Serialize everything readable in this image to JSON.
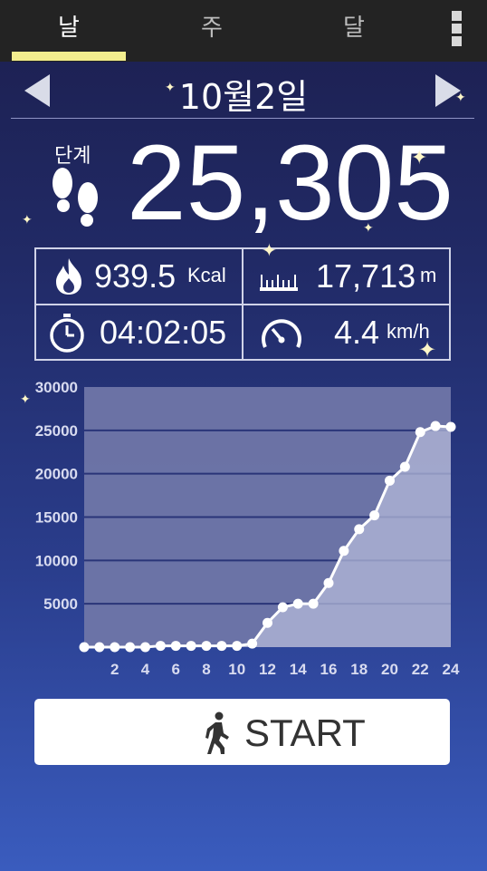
{
  "tabs": [
    {
      "label": "날",
      "active": true
    },
    {
      "label": "주",
      "active": false
    },
    {
      "label": "달",
      "active": false
    }
  ],
  "menu": {
    "icon": "more-vertical-icon"
  },
  "date": {
    "label": "10월2일",
    "prev_icon": "triangle-left-icon",
    "next_icon": "triangle-right-icon"
  },
  "steps": {
    "label": "단계",
    "value": "25,305",
    "icon": "footprints-icon"
  },
  "stats": {
    "calories": {
      "value": "939.5",
      "unit": "Kcal",
      "icon": "flame-icon"
    },
    "distance": {
      "value": "17,713",
      "unit": "m",
      "icon": "ruler-icon"
    },
    "duration": {
      "value": "04:02:05",
      "icon": "stopwatch-icon"
    },
    "speed": {
      "value": "4.4",
      "unit": "km/h",
      "icon": "speedometer-icon"
    }
  },
  "start_button": {
    "label": "START",
    "icon": "walking-person-icon"
  },
  "colors": {
    "accent": "#f3ee8e",
    "tabbar": "#232323",
    "line": "#ffffff"
  },
  "chart_data": {
    "type": "area",
    "x": [
      0,
      1,
      2,
      3,
      4,
      5,
      6,
      7,
      8,
      9,
      10,
      11,
      12,
      13,
      14,
      15,
      16,
      17,
      18,
      19,
      20,
      21,
      22,
      23,
      24
    ],
    "values": [
      0,
      0,
      0,
      0,
      0,
      150,
      150,
      150,
      150,
      150,
      150,
      400,
      2800,
      4600,
      5000,
      5000,
      7400,
      11100,
      13600,
      15200,
      19200,
      20800,
      24800,
      25500,
      25400
    ],
    "x_tick_labels": [
      "2",
      "4",
      "6",
      "8",
      "10",
      "12",
      "14",
      "16",
      "18",
      "20",
      "22",
      "24"
    ],
    "x_ticks": [
      2,
      4,
      6,
      8,
      10,
      12,
      14,
      16,
      18,
      20,
      22,
      24
    ],
    "y_tick_labels": [
      "5000",
      "10000",
      "15000",
      "20000",
      "25000",
      "30000"
    ],
    "y_ticks": [
      5000,
      10000,
      15000,
      20000,
      25000,
      30000
    ],
    "xlim": [
      0,
      24
    ],
    "ylim": [
      0,
      30000
    ],
    "grid": true
  }
}
